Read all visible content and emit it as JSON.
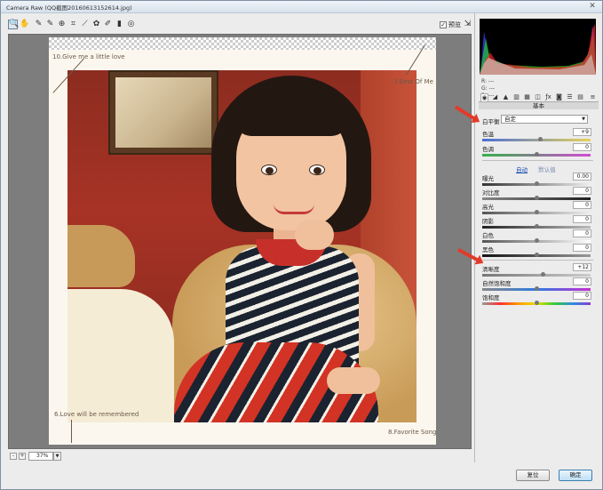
{
  "window": {
    "title": "Camera Raw (QQ截图20160613152614.jpg)",
    "close_glyph": "✕"
  },
  "toolbar": {
    "tools": [
      {
        "icon": "zoom-icon",
        "glyph": "🔍"
      },
      {
        "icon": "hand-icon",
        "glyph": "✋"
      },
      {
        "icon": "white-balance-icon",
        "glyph": "✎"
      },
      {
        "icon": "color-sampler-icon",
        "glyph": "✎"
      },
      {
        "icon": "target-adjust-icon",
        "glyph": "⊕"
      },
      {
        "icon": "crop-icon",
        "glyph": "⌗"
      },
      {
        "icon": "straighten-icon",
        "glyph": "⟋"
      },
      {
        "icon": "spot-removal-icon",
        "glyph": "✿"
      },
      {
        "icon": "brush-icon",
        "glyph": "✐"
      },
      {
        "icon": "graduated-filter-icon",
        "glyph": "▮"
      },
      {
        "icon": "radial-filter-icon",
        "glyph": "◎"
      }
    ],
    "preview_label": "预览",
    "preview_checked": true
  },
  "image": {
    "captions": [
      "10.Give me a little love",
      "3.Best Of Me",
      "6.Love will be remembered",
      "8.Favorite Song"
    ]
  },
  "status": {
    "zoom_out": "-",
    "zoom_in": "+",
    "zoom_value": "37%"
  },
  "panel": {
    "rgb": {
      "r": "R: ---",
      "g": "G: ---",
      "b": "B: ---"
    },
    "section_title": "基本",
    "white_balance": {
      "label": "白平衡",
      "value": "自定"
    },
    "links": {
      "auto": "自动",
      "default": "默认值"
    },
    "sliders": [
      {
        "label": "色温",
        "value": "+9",
        "fraction": 0.53
      },
      {
        "label": "色调",
        "value": "0",
        "fraction": 0.5
      },
      {
        "label": "曝光",
        "value": "0.00",
        "fraction": 0.5
      },
      {
        "label": "对比度",
        "value": "0",
        "fraction": 0.5
      },
      {
        "label": "高光",
        "value": "0",
        "fraction": 0.5
      },
      {
        "label": "阴影",
        "value": "0",
        "fraction": 0.5
      },
      {
        "label": "白色",
        "value": "0",
        "fraction": 0.5
      },
      {
        "label": "黑色",
        "value": "0",
        "fraction": 0.5
      },
      {
        "label": "清晰度",
        "value": "+12",
        "fraction": 0.56
      },
      {
        "label": "自然饱和度",
        "value": "0",
        "fraction": 0.5
      },
      {
        "label": "饱和度",
        "value": "0",
        "fraction": 0.5
      }
    ]
  },
  "buttons": {
    "reset": "复位",
    "ok": "确定"
  }
}
